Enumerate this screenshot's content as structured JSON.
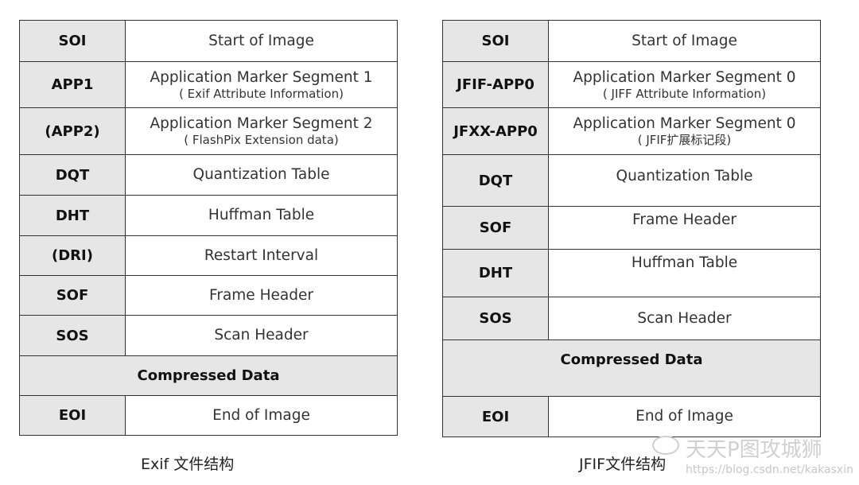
{
  "exif": {
    "caption": "Exif 文件结构",
    "rows": [
      {
        "label": "SOI",
        "main": "Start of Image"
      },
      {
        "label": "APP1",
        "main": "Application Marker Segment 1",
        "sub": "( Exif Attribute Information)"
      },
      {
        "label": "(APP2)",
        "main": "Application Marker Segment 2",
        "sub": "( FlashPix Extension data)"
      },
      {
        "label": "DQT",
        "main": "Quantization Table"
      },
      {
        "label": "DHT",
        "main": "Huffman Table"
      },
      {
        "label": "(DRI)",
        "main": "Restart Interval"
      },
      {
        "label": "SOF",
        "main": "Frame Header"
      },
      {
        "label": "SOS",
        "main": "Scan Header"
      },
      {
        "full": "Compressed Data"
      },
      {
        "label": "EOI",
        "main": "End of Image"
      }
    ]
  },
  "jfif": {
    "caption": "JFIF文件结构",
    "rows": [
      {
        "label": "SOI",
        "main": "Start of Image"
      },
      {
        "label": "JFIF-APP0",
        "main": "Application Marker Segment 0",
        "sub": "( JIFF Attribute Information)"
      },
      {
        "label": "JFXX-APP0",
        "main": "Application Marker Segment 0",
        "sub": "( JFIF扩展标记段)"
      },
      {
        "label": "DQT",
        "main": "Quantization Table"
      },
      {
        "label": "SOF",
        "main": "Frame Header"
      },
      {
        "label": "DHT",
        "main": "Huffman Table"
      },
      {
        "label": "SOS",
        "main": "Scan Header"
      },
      {
        "full": "Compressed Data"
      },
      {
        "label": "EOI",
        "main": "End of Image"
      }
    ]
  },
  "watermark": {
    "name": "天天P图攻城狮",
    "url": "https://blog.csdn.net/kakasxin",
    "icon": "wechat-icon"
  }
}
